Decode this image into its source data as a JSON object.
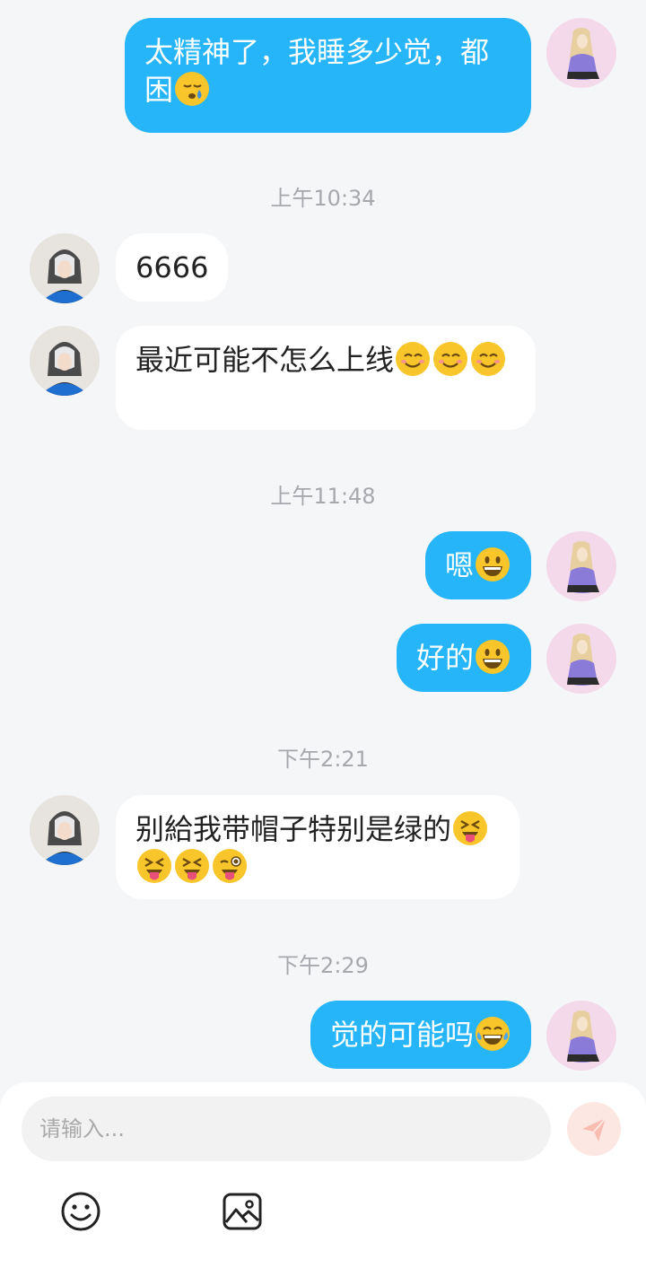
{
  "messages": [
    {
      "side": "right",
      "text": "太精神了，我睡多少觉，都困",
      "emojis": [
        "sleepy-face"
      ]
    },
    {
      "timestamp": "上午10:34"
    },
    {
      "side": "left",
      "text": "6666",
      "emojis": []
    },
    {
      "side": "left",
      "text": "最近可能不怎么上线",
      "emojis": [
        "smiling-face",
        "smiling-face",
        "smiling-face"
      ]
    },
    {
      "timestamp": "上午11:48"
    },
    {
      "side": "right",
      "text": "嗯",
      "emojis": [
        "grinning-face"
      ]
    },
    {
      "side": "right",
      "text": "好的",
      "emojis": [
        "grinning-face"
      ]
    },
    {
      "timestamp": "下午2:21"
    },
    {
      "side": "left",
      "text": "别給我带帽子特别是绿的",
      "emojis": [
        "squinting-tongue-face",
        "squinting-tongue-face",
        "squinting-tongue-face",
        "winking-tongue-face"
      ]
    },
    {
      "timestamp": "下午2:29"
    },
    {
      "side": "right",
      "text": "觉的可能吗",
      "emojis": [
        "tears-of-joy-face"
      ]
    }
  ],
  "composer": {
    "placeholder": "请输入...",
    "send_icon": "send-icon",
    "tools": [
      "emoji-icon",
      "image-icon"
    ]
  },
  "colors": {
    "background": "#f5f6f8",
    "outgoing_bubble": "#26b5f8",
    "incoming_bubble": "#ffffff",
    "timestamp_text": "#a6a8ad",
    "send_button": "#fde7e3"
  }
}
